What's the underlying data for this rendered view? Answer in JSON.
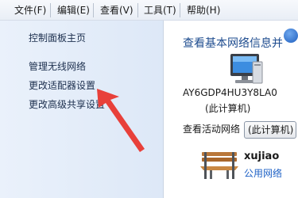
{
  "menubar": {
    "items": [
      {
        "label": "文件(F)"
      },
      {
        "label": "编辑(E)"
      },
      {
        "label": "查看(V)"
      },
      {
        "label": "工具(T)"
      },
      {
        "label": "帮助(H)"
      }
    ]
  },
  "sidebar": {
    "links": [
      {
        "label": "控制面板主页"
      },
      {
        "label": "管理无线网络"
      },
      {
        "label": "更改适配器设置"
      },
      {
        "label": "更改高级共享设置"
      }
    ]
  },
  "main": {
    "title": "查看基本网络信息并",
    "computer_name": "AY6GDP4HU3Y8LA0",
    "computer_caption": "(此计算机)",
    "active_networks_label": "查看活动网络",
    "computer_button_label": "(此计算机)",
    "network": {
      "name": "xujiao",
      "type": "公用网络"
    }
  },
  "icons": {
    "monitor": "computer-monitor-icon",
    "bench": "public-network-bench-icon",
    "help": "help-icon"
  },
  "colors": {
    "title": "#1e4c8f",
    "link": "#1f62c6",
    "annotation_arrow": "#e8403a",
    "sidebar_bg": "#e3ecf8"
  }
}
